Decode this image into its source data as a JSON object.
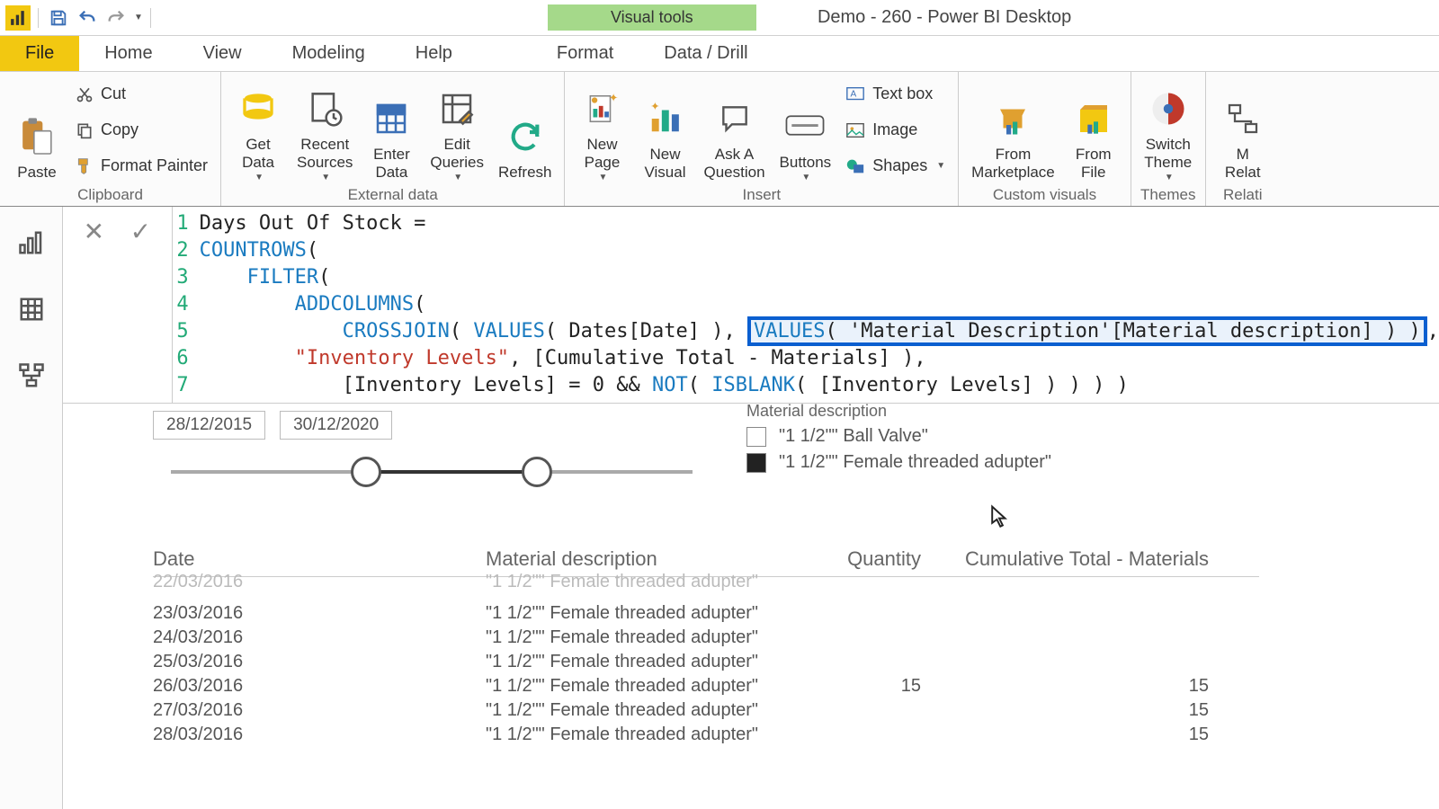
{
  "titlebar": {
    "contextual_tab": "Visual tools",
    "doc_title": "Demo - 260 - Power BI Desktop"
  },
  "tabs": {
    "file": "File",
    "home": "Home",
    "view": "View",
    "modeling": "Modeling",
    "help": "Help",
    "format": "Format",
    "data_drill": "Data / Drill"
  },
  "ribbon": {
    "clipboard": {
      "title": "Clipboard",
      "paste": "Paste",
      "cut": "Cut",
      "copy": "Copy",
      "fp": "Format Painter"
    },
    "external": {
      "title": "External data",
      "get": "Get\nData",
      "recent": "Recent\nSources",
      "enter": "Enter\nData",
      "edit": "Edit\nQueries",
      "refresh": "Refresh"
    },
    "insert": {
      "title": "Insert",
      "np": "New\nPage",
      "nv": "New\nVisual",
      "ask": "Ask A\nQuestion",
      "btns": "Buttons",
      "textbox": "Text box",
      "image": "Image",
      "shapes": "Shapes"
    },
    "custom": {
      "title": "Custom visuals",
      "market": "From\nMarketplace",
      "file": "From\nFile"
    },
    "themes": {
      "title": "Themes",
      "switch": "Switch\nTheme"
    },
    "rel": {
      "title": "Relati",
      "btn": "M\nRelat"
    }
  },
  "formula": {
    "lines": [
      "Days Out Of Stock =",
      "COUNTROWS(",
      "    FILTER(",
      "        ADDCOLUMNS(",
      "            CROSSJOIN( VALUES( Dates[Date] ),",
      "        \"Inventory Levels\", [Cumulative Total - Materials] ),",
      "            [Inventory Levels] = 0 && NOT( ISBLANK( [Inventory Levels] ) ) ) )"
    ],
    "highlighted": "VALUES( 'Material Description'[Material description] ) )"
  },
  "slicer_date": {
    "from": "28/12/2015",
    "to": "30/12/2020"
  },
  "slicer_mat": {
    "title": "Material description",
    "opt1": "\"1 1/2\"\" Ball Valve\"",
    "opt2": "\"1 1/2\"\" Female threaded adupter\""
  },
  "table": {
    "h1": "Date",
    "h2": "Material description",
    "h3": "Quantity",
    "h4": "Cumulative Total - Materials",
    "rows": [
      {
        "d": "22/03/2016",
        "m": "\"1 1/2\"\" Female threaded adupter\"",
        "q": "",
        "c": "",
        "cut": true
      },
      {
        "d": "23/03/2016",
        "m": "\"1 1/2\"\" Female threaded adupter\"",
        "q": "",
        "c": ""
      },
      {
        "d": "24/03/2016",
        "m": "\"1 1/2\"\" Female threaded adupter\"",
        "q": "",
        "c": ""
      },
      {
        "d": "25/03/2016",
        "m": "\"1 1/2\"\" Female threaded adupter\"",
        "q": "",
        "c": ""
      },
      {
        "d": "26/03/2016",
        "m": "\"1 1/2\"\" Female threaded adupter\"",
        "q": "15",
        "c": "15"
      },
      {
        "d": "27/03/2016",
        "m": "\"1 1/2\"\" Female threaded adupter\"",
        "q": "",
        "c": "15"
      },
      {
        "d": "28/03/2016",
        "m": "\"1 1/2\"\" Female threaded adupter\"",
        "q": "",
        "c": "15"
      }
    ]
  }
}
